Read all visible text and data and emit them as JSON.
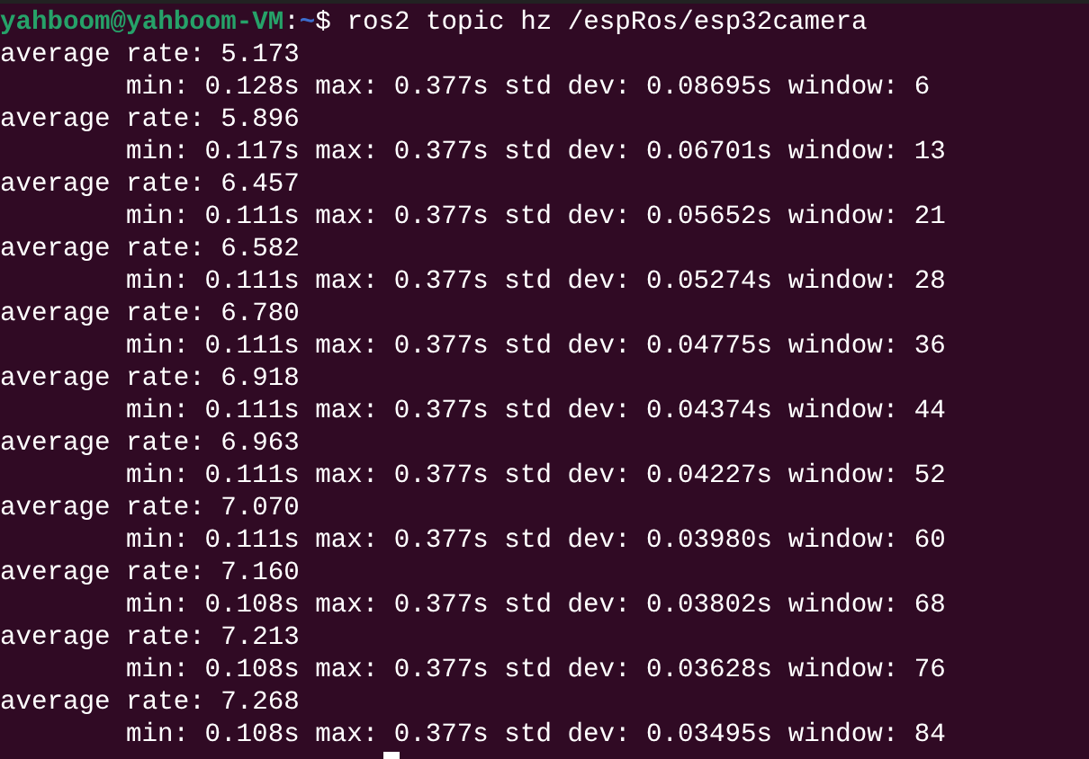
{
  "terminal": {
    "prompt": {
      "user_host": "yahboom@yahboom-VM",
      "separator": ":",
      "path": "~",
      "symbol": "$",
      "command": "ros2 topic hz /espRos/esp32camera"
    },
    "output": [
      {
        "rate": "average rate: 5.173",
        "stats": "min: 0.128s max: 0.377s std dev: 0.08695s window: 6"
      },
      {
        "rate": "average rate: 5.896",
        "stats": "min: 0.117s max: 0.377s std dev: 0.06701s window: 13"
      },
      {
        "rate": "average rate: 6.457",
        "stats": "min: 0.111s max: 0.377s std dev: 0.05652s window: 21"
      },
      {
        "rate": "average rate: 6.582",
        "stats": "min: 0.111s max: 0.377s std dev: 0.05274s window: 28"
      },
      {
        "rate": "average rate: 6.780",
        "stats": "min: 0.111s max: 0.377s std dev: 0.04775s window: 36"
      },
      {
        "rate": "average rate: 6.918",
        "stats": "min: 0.111s max: 0.377s std dev: 0.04374s window: 44"
      },
      {
        "rate": "average rate: 6.963",
        "stats": "min: 0.111s max: 0.377s std dev: 0.04227s window: 52"
      },
      {
        "rate": "average rate: 7.070",
        "stats": "min: 0.111s max: 0.377s std dev: 0.03980s window: 60"
      },
      {
        "rate": "average rate: 7.160",
        "stats": "min: 0.108s max: 0.377s std dev: 0.03802s window: 68"
      },
      {
        "rate": "average rate: 7.213",
        "stats": "min: 0.108s max: 0.377s std dev: 0.03628s window: 76"
      },
      {
        "rate": "average rate: 7.268",
        "stats": "min: 0.108s max: 0.377s std dev: 0.03495s window: 84"
      }
    ]
  }
}
